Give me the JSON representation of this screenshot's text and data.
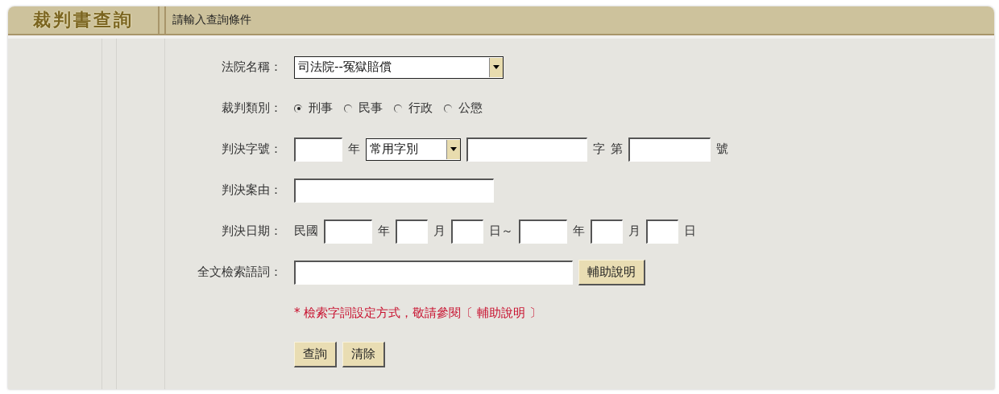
{
  "header": {
    "title": "裁判書查詢",
    "subtitle": "請輸入查詢條件"
  },
  "rows": [
    {
      "label": "法院名稱：",
      "items": [
        {
          "kind": "select",
          "value": "司法院--冤獄賠償"
        }
      ]
    },
    {
      "label": "裁判類別：",
      "items": [
        {
          "kind": "radios",
          "options": [
            {
              "label": "刑事",
              "selected": true
            },
            {
              "label": "民事",
              "selected": false
            },
            {
              "label": "行政",
              "selected": false
            },
            {
              "label": "公懲",
              "selected": false
            }
          ]
        }
      ]
    },
    {
      "label": "判決字號：",
      "items": [
        {
          "kind": "input"
        },
        {
          "kind": "text",
          "text": "年"
        },
        {
          "kind": "select",
          "value": "常用字別"
        },
        {
          "kind": "input"
        },
        {
          "kind": "text",
          "text": "字"
        },
        {
          "kind": "text",
          "text": "第"
        },
        {
          "kind": "input"
        },
        {
          "kind": "text",
          "text": "號"
        }
      ]
    },
    {
      "label": "判決案由：",
      "items": [
        {
          "kind": "input"
        }
      ]
    },
    {
      "label": "判決日期：",
      "items": [
        {
          "kind": "text",
          "text": "民國"
        },
        {
          "kind": "input"
        },
        {
          "kind": "text",
          "text": "年"
        },
        {
          "kind": "input"
        },
        {
          "kind": "text",
          "text": "月"
        },
        {
          "kind": "input"
        },
        {
          "kind": "text",
          "text": "日～"
        },
        {
          "kind": "input"
        },
        {
          "kind": "text",
          "text": "年"
        },
        {
          "kind": "input"
        },
        {
          "kind": "text",
          "text": "月"
        },
        {
          "kind": "input"
        },
        {
          "kind": "text",
          "text": "日"
        }
      ]
    },
    {
      "label": "全文檢索語詞：",
      "items": [
        {
          "kind": "input"
        },
        {
          "kind": "button",
          "text": "輔助說明"
        }
      ]
    },
    {
      "items": [
        {
          "kind": "note",
          "text": "* 檢索字詞設定方式，敬請參閱〔 輔助說明 〕"
        }
      ]
    },
    {
      "items": [
        {
          "kind": "button",
          "text": "查詢"
        },
        {
          "kind": "button",
          "text": "清除"
        }
      ]
    }
  ]
}
